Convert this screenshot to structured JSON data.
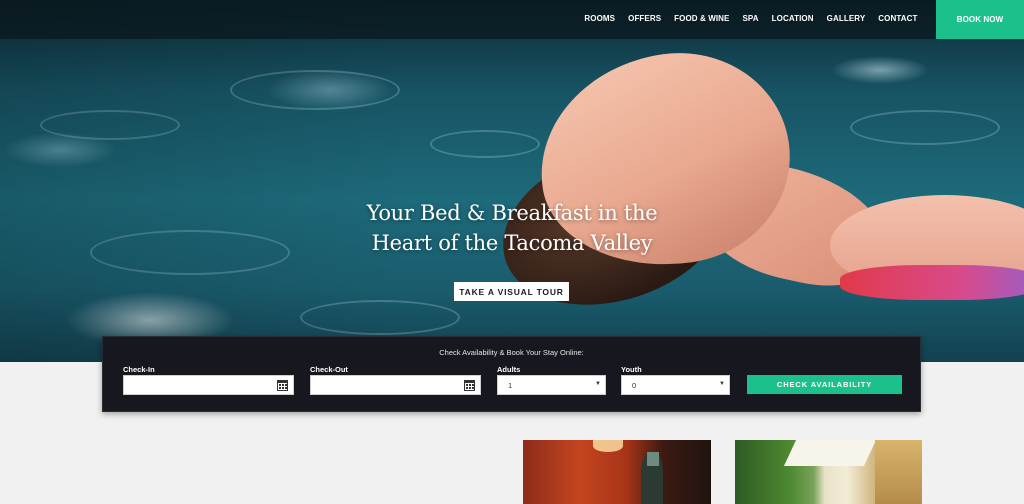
{
  "nav": {
    "items": [
      "ROOMS",
      "OFFERS",
      "FOOD & WINE",
      "SPA",
      "LOCATION",
      "GALLERY",
      "CONTACT"
    ],
    "book_now": "BOOK NOW",
    "accent_color": "#1cc08b"
  },
  "hero": {
    "title_line1": "Your Bed & Breakfast in the",
    "title_line2": "Heart of the Tacoma Valley",
    "tour_button": "TAKE A VISUAL TOUR"
  },
  "booking": {
    "title": "Check Availability & Book Your Stay Online:",
    "checkin_label": "Check-In",
    "checkin_value": "",
    "checkout_label": "Check-Out",
    "checkout_value": "",
    "adults_label": "Adults",
    "adults_value": "1",
    "youth_label": "Youth",
    "youth_value": "0",
    "check_button": "CHECK AVAILABILITY",
    "calendar_icon": "calendar-icon",
    "dropdown_icon": "chevron-down-icon"
  }
}
